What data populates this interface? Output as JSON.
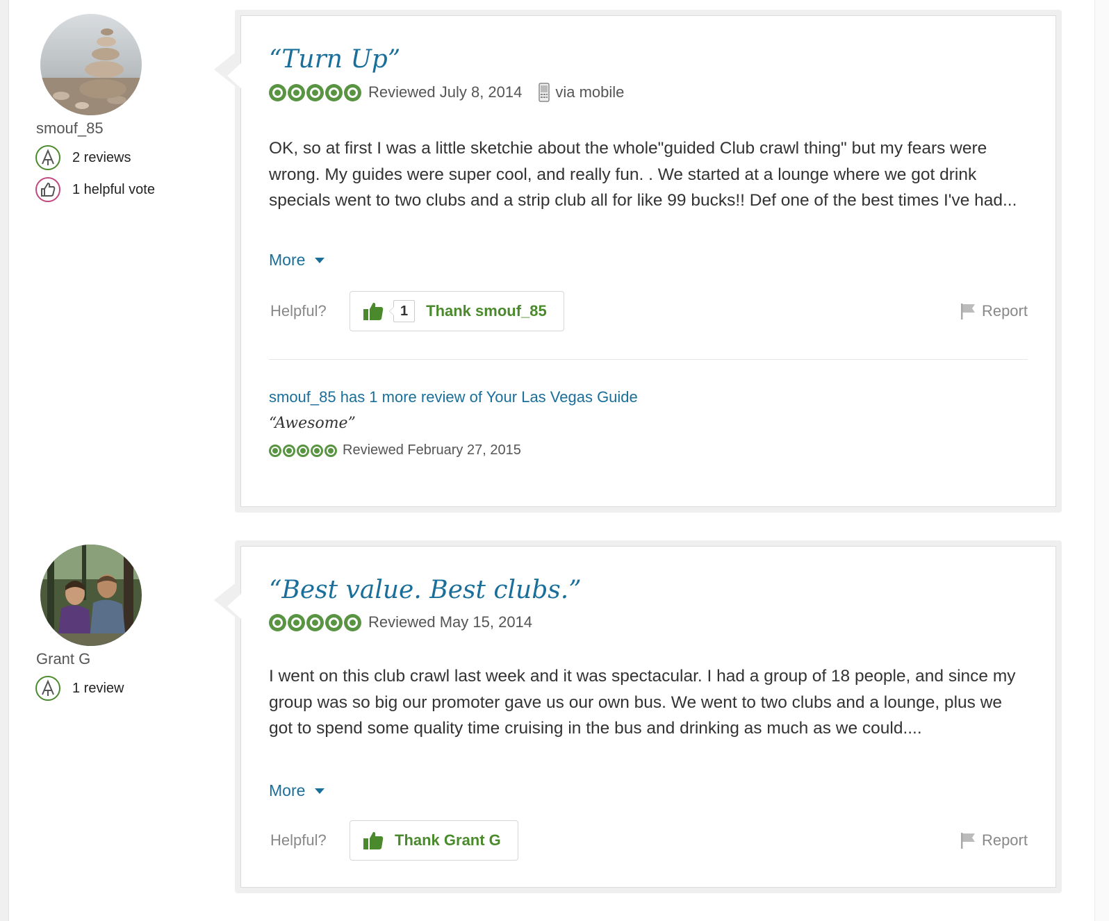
{
  "reviews": [
    {
      "member": {
        "name": "smouf_85",
        "badges": [
          {
            "label": "2 reviews",
            "icon": "reviewer-badge-icon"
          },
          {
            "label": "1 helpful vote",
            "icon": "helpful-vote-badge-icon"
          }
        ]
      },
      "title": "“Turn Up”",
      "rating": 5,
      "reviewed": "Reviewed July 8, 2014",
      "via": "via mobile",
      "body": "OK, so at first I was a little sketchie about the whole\"guided Club crawl thing\" but my fears were wrong. My guides were super cool, and really fun. . We started at a lounge where we got drink specials went to two clubs and a strip club all for like 99 bucks!! Def one of the best times I've had...",
      "more_label": "More",
      "helpful_label": "Helpful?",
      "thank_count": "1",
      "thank_label": "Thank smouf_85",
      "report_label": "Report",
      "more_reviews": {
        "link": "smouf_85 has 1 more review of Your Las Vegas Guide",
        "title": "“Awesome”",
        "rating": 5,
        "reviewed": "Reviewed February 27, 2015"
      }
    },
    {
      "member": {
        "name": "Grant G",
        "badges": [
          {
            "label": "1 review",
            "icon": "reviewer-badge-icon"
          }
        ]
      },
      "title": "“Best value. Best clubs.”",
      "rating": 5,
      "reviewed": "Reviewed May 15, 2014",
      "body": "I went on this club crawl last week and it was spectacular. I had a group of 18 people, and since my group was so big our promoter gave us our own bus. We went to two clubs and a lounge, plus we got to spend some quality time cruising in the bus and drinking as much as we could....",
      "more_label": "More",
      "helpful_label": "Helpful?",
      "thank_label": "Thank Grant G",
      "report_label": "Report"
    }
  ],
  "colors": {
    "link": "#1a6e9a",
    "bubble": "#589442",
    "thank": "#4a8a2d",
    "reviewer_badge": "#4a8a2d",
    "helpful_badge": "#c0467e"
  }
}
